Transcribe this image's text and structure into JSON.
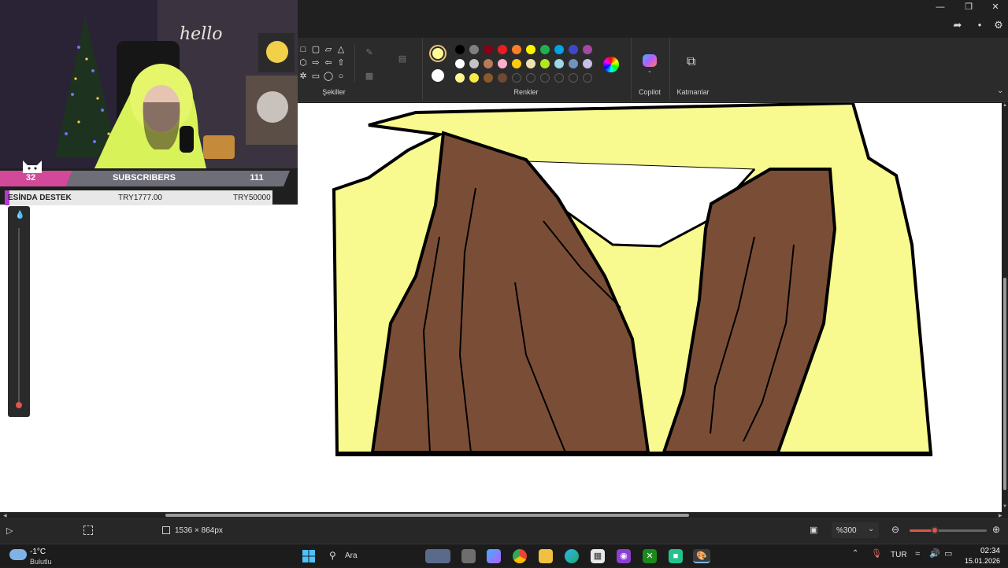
{
  "ribbon": {
    "shapes_label": "Şekiller",
    "colors_label": "Renkler",
    "copilot_label": "Copilot",
    "layers_label": "Katmanlar",
    "palette_row1": [
      "#000000",
      "#7f7f7f",
      "#880015",
      "#ed1c24",
      "#ff7f27",
      "#fff200",
      "#22b14c",
      "#00a2e8",
      "#3f48cc",
      "#a349a4"
    ],
    "palette_row2": [
      "#ffffff",
      "#c3c3c3",
      "#b97a57",
      "#ffaec9",
      "#ffc90e",
      "#efe4b0",
      "#b5e61d",
      "#99d9ea",
      "#7092be",
      "#c8bfe7"
    ],
    "palette_row3": [
      "#fff68f",
      "#f6e948",
      "#8b5a2b",
      "#6e4a34"
    ],
    "primary_color": "#fffb94",
    "secondary_color": "#ffffff"
  },
  "overlay": {
    "subs_left": "32",
    "subs_title": "SUBSCRIBERS",
    "subs_right": "111",
    "donation_name": "ESİNDA DESTEK",
    "donation_amount": "TRY1777.00",
    "donation_goal": "TRY50000",
    "wall_text": "hello"
  },
  "drawing": {
    "skin_color": "#f8f98f",
    "hair_color": "#7a4e36",
    "outline_color": "#000000"
  },
  "statusbar": {
    "canvas_size": "1536 × 864px",
    "zoom": "%300"
  },
  "taskbar": {
    "weather_temp": "-1°C",
    "weather_desc": "Bulutlu",
    "search_label": "Ara",
    "language": "TUR",
    "time": "02:34",
    "date": "15.01.2026"
  }
}
